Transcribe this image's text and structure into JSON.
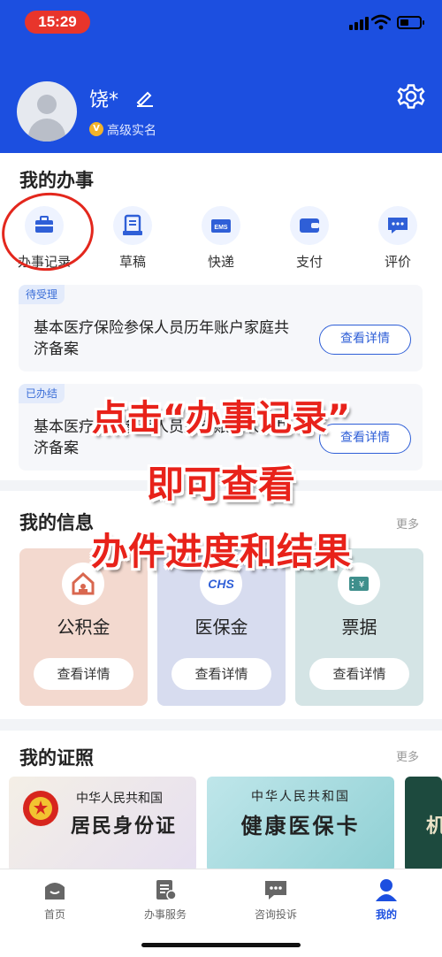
{
  "status_bar": {
    "time": "15:29"
  },
  "profile": {
    "name": "饶*",
    "verification": "高级实名",
    "badge": "V"
  },
  "my_affairs": {
    "title": "我的办事",
    "shortcuts": [
      {
        "label": "办事记录",
        "icon": "briefcase-icon"
      },
      {
        "label": "草稿",
        "icon": "draft-icon"
      },
      {
        "label": "快递",
        "icon": "ems-icon"
      },
      {
        "label": "支付",
        "icon": "wallet-icon"
      },
      {
        "label": "评价",
        "icon": "comment-icon"
      }
    ],
    "tasks": [
      {
        "status": "待受理",
        "title": "基本医疗保险参保人员历年账户家庭共济备案",
        "button": "查看详情"
      },
      {
        "status": "已办结",
        "title": "基本医疗保险参保人员历年账户家庭共济备案",
        "button": "查看详情"
      }
    ]
  },
  "my_info": {
    "title": "我的信息",
    "more": "更多",
    "cards": [
      {
        "name": "公积金",
        "button": "查看详情",
        "bg": "#f3d9cf",
        "icon": "house-icon"
      },
      {
        "name": "医保金",
        "button": "查看详情",
        "bg": "#d7dcef",
        "icon": "chs-logo-icon",
        "logo_text": "CHS"
      },
      {
        "name": "票据",
        "button": "查看详情",
        "bg": "#d4e4e5",
        "icon": "receipt-icon"
      }
    ]
  },
  "my_certs": {
    "title": "我的证照",
    "more": "更多",
    "certs": [
      {
        "line1": "中华人民共和国",
        "line2": "居民身份证"
      },
      {
        "line1": "中华人民共和国",
        "line2": "健康医保卡"
      },
      {
        "partial": "机"
      }
    ]
  },
  "tabs": [
    {
      "label": "首页",
      "icon": "home-icon",
      "active": false
    },
    {
      "label": "办事服务",
      "icon": "service-icon",
      "active": false
    },
    {
      "label": "咨询投诉",
      "icon": "consult-icon",
      "active": false
    },
    {
      "label": "我的",
      "icon": "user-icon",
      "active": true
    }
  ],
  "overlay_text": [
    "点击“办事记录”",
    "即可查看",
    "办件进度和结果"
  ],
  "colors": {
    "brand_blue": "#1c4fe0",
    "annotation_red": "#e8221a"
  }
}
